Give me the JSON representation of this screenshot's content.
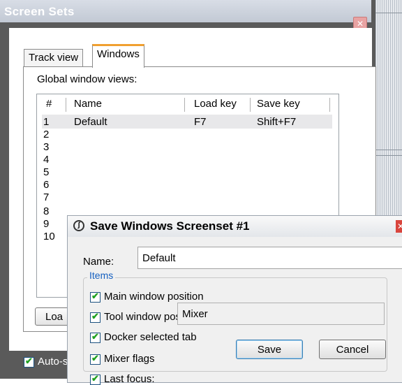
{
  "background_window": {
    "title": "Screen Sets",
    "close_glyph": "✕",
    "tabs": [
      "Track view",
      "Windows"
    ],
    "active_tab": "Windows",
    "global_label": "Global window views:",
    "columns": [
      "#",
      "Name",
      "Load key",
      "Save key"
    ],
    "rows": [
      {
        "num": "1",
        "name": "Default",
        "load_key": "F7",
        "save_key": "Shift+F7"
      },
      {
        "num": "2",
        "name": "",
        "load_key": "",
        "save_key": ""
      },
      {
        "num": "3"
      },
      {
        "num": "4"
      },
      {
        "num": "5"
      },
      {
        "num": "6"
      },
      {
        "num": "7"
      },
      {
        "num": "8"
      },
      {
        "num": "9"
      },
      {
        "num": "10"
      }
    ],
    "load_button": "Loa",
    "autosave_label": "Auto-s"
  },
  "dialog": {
    "title": "Save Windows Screenset #1",
    "icon": "reaper-logo-icon",
    "close_glyph": "✕",
    "name_label": "Name:",
    "name_value": "Default",
    "items_legend": "Items",
    "checkboxes": [
      {
        "label": "Main window position",
        "checked": true
      },
      {
        "label": "Tool window positions",
        "checked": true
      },
      {
        "label": "Docker selected tab",
        "checked": true
      },
      {
        "label": "Mixer flags",
        "checked": true
      },
      {
        "label": "Last focus:",
        "checked": true
      }
    ],
    "last_focus_value": "Mixer",
    "save_label": "Save",
    "cancel_label": "Cancel"
  },
  "colors": {
    "checkmark": "#21a121",
    "legend_text": "#1560c0",
    "close_red": "#d9453d",
    "active_tab_accent": "#f0a030"
  }
}
